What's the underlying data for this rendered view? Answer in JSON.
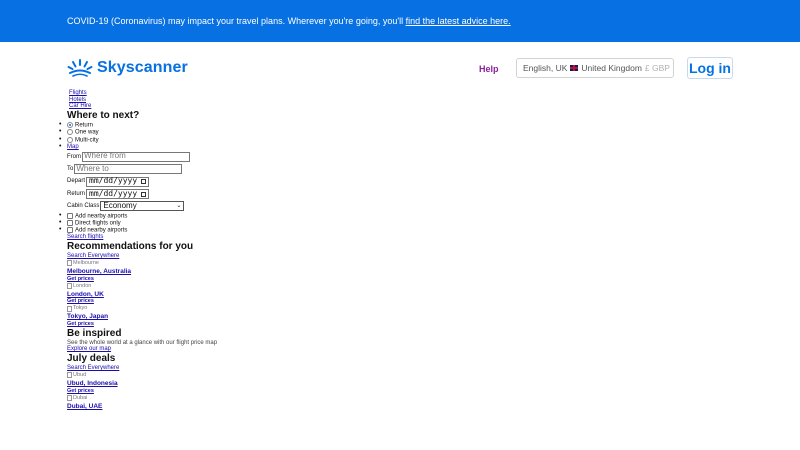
{
  "banner": {
    "text": "COVID-19 (Coronavirus) may impact your travel plans. Wherever you're going, you'll",
    "link": "find the latest advice here."
  },
  "header": {
    "brand": "Skyscanner",
    "help": "Help",
    "locale_lang": "English, UK",
    "locale_country": "United Kingdom",
    "locale_currency": "£ GBP",
    "login": "Log in"
  },
  "tabs": [
    "Flights",
    "Hotels",
    "Car Hire"
  ],
  "search": {
    "heading": "Where to next?",
    "trip_types": [
      "Return",
      "One way",
      "Multi-city"
    ],
    "map_link": "Map",
    "from_label": "From",
    "from_placeholder": "Where from",
    "to_label": "To",
    "to_placeholder": "Where to",
    "depart_label": "Depart",
    "depart_value": "mm/dd/yyyy",
    "return_label": "Return",
    "return_value": "mm/dd/yyyy",
    "cabin_label": "Cabin Class",
    "cabin_value": "Economy",
    "options": [
      "Add nearby airports",
      "Direct flights only",
      "Add nearby airports"
    ],
    "submit": "Search flights"
  },
  "recommendations": {
    "heading": "Recommendations for you",
    "search_everywhere": "Search Everywhere",
    "items": [
      {
        "img_alt": "Melbourne",
        "name": "Melbourne, Australia",
        "cta": "Get prices"
      },
      {
        "img_alt": "London",
        "name": "London, UK",
        "cta": "Get prices"
      },
      {
        "img_alt": "Tokyo",
        "name": "Tokyo, Japan",
        "cta": "Get prices"
      }
    ]
  },
  "inspired": {
    "heading": "Be inspired",
    "text": "See the whole world at a glance with our flight price map",
    "link": "Explore our map"
  },
  "july": {
    "heading": "July deals",
    "search_everywhere": "Search Everywhere",
    "items": [
      {
        "img_alt": "Ubud",
        "name": "Ubud, Indonesia",
        "cta": "Get prices"
      },
      {
        "img_alt": "Dubai",
        "name": "Dubai, UAE"
      }
    ]
  },
  "colors": {
    "banner": "#0770e3",
    "brand": "#0770e3",
    "help": "#8c1f9c"
  }
}
